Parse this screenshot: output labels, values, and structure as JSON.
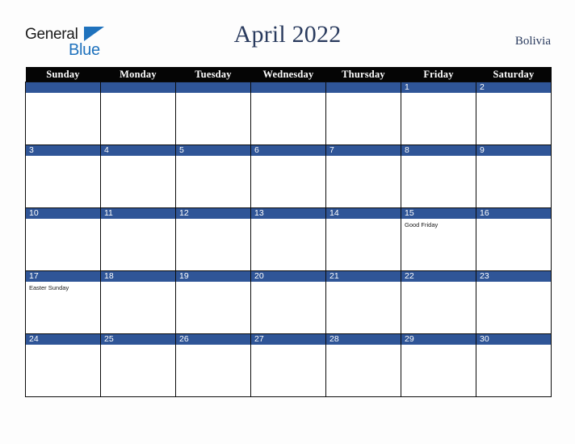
{
  "brand": {
    "name_part1": "General",
    "name_part2": "Blue",
    "triangle_icon": "blue-triangle-icon"
  },
  "header": {
    "title": "April 2022",
    "country": "Bolivia"
  },
  "colors": {
    "date_band": "#2f5597",
    "header_row": "#050505",
    "title_text": "#2a3b5e",
    "brand_blue": "#1f72bd",
    "page_background": "#fdfdfd",
    "cell_background": "#ffffff",
    "grid_line": "#0b0b0b"
  },
  "calendar": {
    "month": "April",
    "year": "2022",
    "weekday_headers": [
      "Sunday",
      "Monday",
      "Tuesday",
      "Wednesday",
      "Thursday",
      "Friday",
      "Saturday"
    ],
    "weeks": [
      [
        {
          "date": "",
          "events": []
        },
        {
          "date": "",
          "events": []
        },
        {
          "date": "",
          "events": []
        },
        {
          "date": "",
          "events": []
        },
        {
          "date": "",
          "events": []
        },
        {
          "date": "1",
          "events": []
        },
        {
          "date": "2",
          "events": []
        }
      ],
      [
        {
          "date": "3",
          "events": []
        },
        {
          "date": "4",
          "events": []
        },
        {
          "date": "5",
          "events": []
        },
        {
          "date": "6",
          "events": []
        },
        {
          "date": "7",
          "events": []
        },
        {
          "date": "8",
          "events": []
        },
        {
          "date": "9",
          "events": []
        }
      ],
      [
        {
          "date": "10",
          "events": []
        },
        {
          "date": "11",
          "events": []
        },
        {
          "date": "12",
          "events": []
        },
        {
          "date": "13",
          "events": []
        },
        {
          "date": "14",
          "events": []
        },
        {
          "date": "15",
          "events": [
            "Good Friday"
          ]
        },
        {
          "date": "16",
          "events": []
        }
      ],
      [
        {
          "date": "17",
          "events": [
            "Easter Sunday"
          ]
        },
        {
          "date": "18",
          "events": []
        },
        {
          "date": "19",
          "events": []
        },
        {
          "date": "20",
          "events": []
        },
        {
          "date": "21",
          "events": []
        },
        {
          "date": "22",
          "events": []
        },
        {
          "date": "23",
          "events": []
        }
      ],
      [
        {
          "date": "24",
          "events": []
        },
        {
          "date": "25",
          "events": []
        },
        {
          "date": "26",
          "events": []
        },
        {
          "date": "27",
          "events": []
        },
        {
          "date": "28",
          "events": []
        },
        {
          "date": "29",
          "events": []
        },
        {
          "date": "30",
          "events": []
        }
      ]
    ]
  }
}
